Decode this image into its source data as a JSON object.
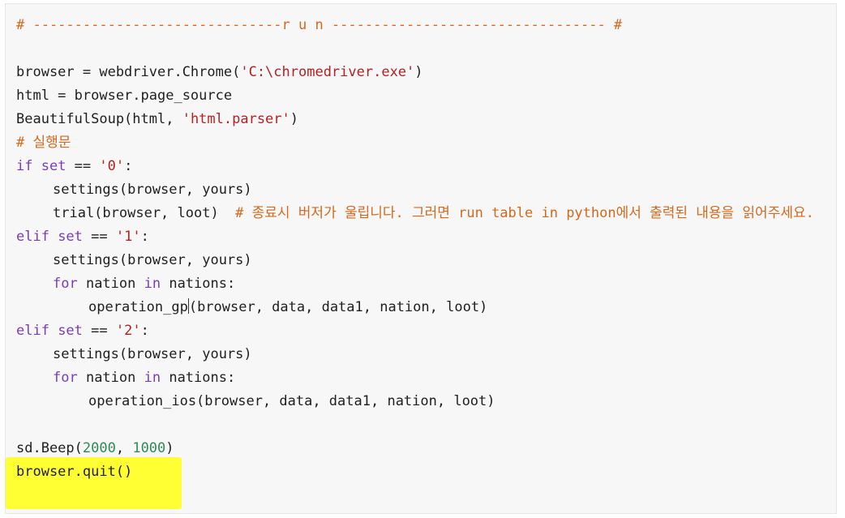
{
  "lines": {
    "run_header": "# ------------------------------r u n --------------------------------- #",
    "l_browser_var": "browser = webdriver.Chrome(",
    "l_browser_str": "'C:\\chromedriver.exe'",
    "l_browser_close": ")",
    "l_html": "html = browser.page_source",
    "l_bs_a": "BeautifulSoup(html, ",
    "l_bs_str": "'html.parser'",
    "l_bs_close": ")",
    "l_comment_exec": "# 실행문",
    "l_if_kw": "if",
    "l_if_set": " set",
    "l_if_eq": " == ",
    "l_if_str": "'0'",
    "l_if_colon": ":",
    "l_settings1": "settings(browser, yours)",
    "l_trial": "trial(browser, loot)  ",
    "l_trial_comment": "# 종료시 버저가 울립니다. 그러면 run table in python에서 출력된 내용을 읽어주세요.",
    "l_elif1_kw": "elif",
    "l_elif1_set": " set",
    "l_elif1_eq": " == ",
    "l_elif1_str": "'1'",
    "l_elif1_colon": ":",
    "l_settings2": "settings(browser, yours)",
    "l_for1_kw": "for",
    "l_for1_mid": " nation ",
    "l_for1_in": "in",
    "l_for1_end": " nations:",
    "l_op_gp_a": "operation_gp",
    "l_op_gp_b": "(browser, data, data1, nation, loot)",
    "l_elif2_kw": "elif",
    "l_elif2_set": " set",
    "l_elif2_eq": " == ",
    "l_elif2_str": "'2'",
    "l_elif2_colon": ":",
    "l_settings3": "settings(browser, yours)",
    "l_for2_kw": "for",
    "l_for2_mid": " nation ",
    "l_for2_in": "in",
    "l_for2_end": " nations:",
    "l_op_ios": "operation_ios(browser, data, data1, nation, loot)",
    "l_beep_a": "sd.Beep(",
    "l_beep_n1": "2000",
    "l_beep_sep": ", ",
    "l_beep_n2": "1000",
    "l_beep_close": ")",
    "l_quit": "browser.quit()"
  },
  "colors": {
    "comment": "#d2691e",
    "string": "#b22222",
    "keyword": "#7a3db8",
    "number": "#2e8b57",
    "highlight": "#ffff33",
    "background": "#f7f7f7"
  }
}
